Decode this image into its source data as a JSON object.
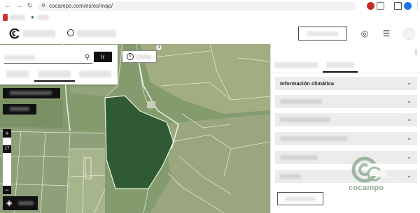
{
  "browser": {
    "url": "cocampo.com/es/es/map/",
    "nav": {
      "back_icon": "arrow-left-icon",
      "forward_icon": "arrow-right-icon",
      "reload_icon": "reload-icon"
    }
  },
  "search": {
    "button_label": "Ir"
  },
  "map": {
    "info_badge": "1",
    "zoom_in_label": "+",
    "zoom_out_label": "−",
    "zoom_level": "17"
  },
  "panel": {
    "sections": [
      {
        "title": "Información climática"
      }
    ]
  },
  "watermark": {
    "text": "cocampo"
  },
  "colors": {
    "field_dark": "#2f5a33",
    "parcel_line": "#f2f4ea",
    "panel_bg": "#ececec",
    "control_dark": "#111111"
  }
}
